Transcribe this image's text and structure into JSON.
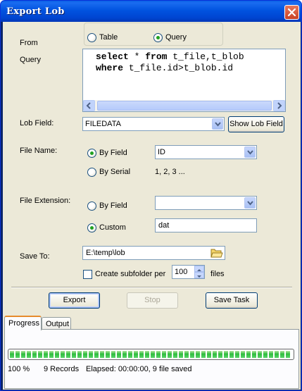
{
  "window": {
    "title": "Export Lob"
  },
  "from": {
    "label": "From",
    "options": [
      {
        "label": "Table",
        "selected": false
      },
      {
        "label": "Query",
        "selected": true
      }
    ]
  },
  "query": {
    "label": "Query",
    "lines": [
      [
        {
          "text": "select",
          "bold": true
        },
        {
          "text": " * ",
          "bold": false
        },
        {
          "text": "from",
          "bold": true
        },
        {
          "text": " t_file,t_blob",
          "bold": false
        }
      ],
      [
        {
          "text": "where",
          "bold": true
        },
        {
          "text": " t_file.id>t_blob.id",
          "bold": false
        }
      ]
    ]
  },
  "lob_field": {
    "label": "Lob Field:",
    "value": "FILEDATA",
    "button": "Show Lob Field"
  },
  "file_name": {
    "label": "File Name:",
    "by_field_label": "By Field",
    "by_field_selected": true,
    "by_field_value": "ID",
    "by_serial_label": "By Serial",
    "by_serial_example": "1, 2, 3 ..."
  },
  "file_extension": {
    "label": "File Extension:",
    "by_field_label": "By Field",
    "by_field_value": "",
    "custom_label": "Custom",
    "custom_selected": true,
    "custom_value": "dat"
  },
  "save_to": {
    "label": "Save To:",
    "path": "E:\\temp\\lob",
    "subfolder_label": "Create subfolder per",
    "subfolder_checked": false,
    "files_count": "100",
    "files_label": "files"
  },
  "actions": {
    "export": "Export",
    "stop": "Stop",
    "save_task": "Save Task"
  },
  "tabs": [
    {
      "label": "Progress",
      "active": true
    },
    {
      "label": "Output",
      "active": false
    }
  ],
  "progress": {
    "percent_value": 1.0,
    "percent": "100 %",
    "records": "9 Records",
    "elapsed": "Elapsed: 00:00:00, 9 file saved"
  },
  "colors": {
    "title_bar": "#0054e3",
    "progress_fill": "#2ebd3d",
    "tab_highlight": "#e68b2c"
  }
}
